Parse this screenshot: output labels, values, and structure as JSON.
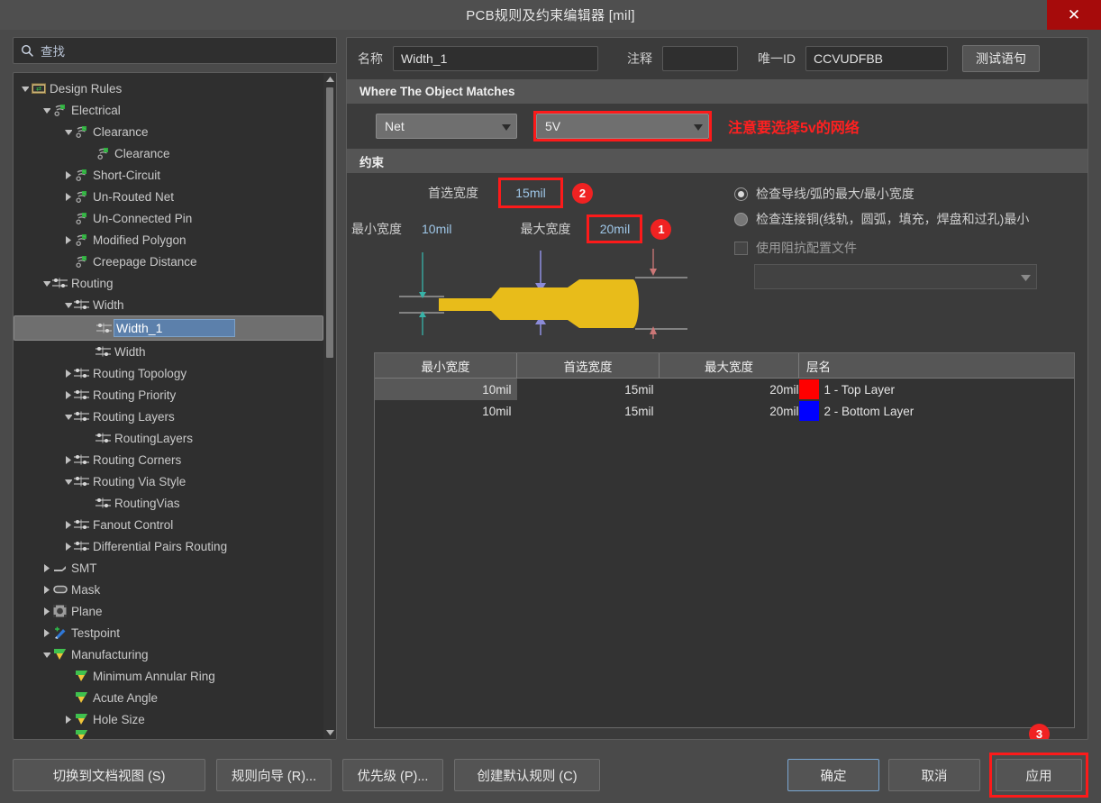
{
  "window": {
    "title": "PCB规则及约束编辑器 [mil]",
    "close_label": "✕"
  },
  "search": {
    "placeholder": "查找",
    "value": "查找",
    "icon": "search-icon"
  },
  "tree": {
    "items": [
      {
        "label": "Design Rules",
        "depth": 0,
        "arrow": "down",
        "icon": "design-rules-folder-icon",
        "selected": false
      },
      {
        "label": "Electrical",
        "depth": 1,
        "arrow": "down",
        "icon": "electrical-icon",
        "selected": false
      },
      {
        "label": "Clearance",
        "depth": 2,
        "arrow": "down",
        "icon": "electrical-icon",
        "selected": false
      },
      {
        "label": "Clearance",
        "depth": 3,
        "arrow": "none",
        "icon": "electrical-icon",
        "selected": false
      },
      {
        "label": "Short-Circuit",
        "depth": 2,
        "arrow": "right",
        "icon": "electrical-icon",
        "selected": false
      },
      {
        "label": "Un-Routed Net",
        "depth": 2,
        "arrow": "right",
        "icon": "electrical-icon",
        "selected": false
      },
      {
        "label": "Un-Connected Pin",
        "depth": 2,
        "arrow": "none",
        "icon": "electrical-icon",
        "selected": false
      },
      {
        "label": "Modified Polygon",
        "depth": 2,
        "arrow": "right",
        "icon": "electrical-icon",
        "selected": false
      },
      {
        "label": "Creepage Distance",
        "depth": 2,
        "arrow": "none",
        "icon": "electrical-icon",
        "selected": false
      },
      {
        "label": "Routing",
        "depth": 1,
        "arrow": "down",
        "icon": "routing-icon",
        "selected": false
      },
      {
        "label": "Width",
        "depth": 2,
        "arrow": "down",
        "icon": "routing-icon",
        "selected": false
      },
      {
        "label": "Width_1",
        "depth": 3,
        "arrow": "none",
        "icon": "routing-icon",
        "selected": true
      },
      {
        "label": "Width",
        "depth": 3,
        "arrow": "none",
        "icon": "routing-icon",
        "selected": false
      },
      {
        "label": "Routing Topology",
        "depth": 2,
        "arrow": "right",
        "icon": "routing-icon",
        "selected": false
      },
      {
        "label": "Routing Priority",
        "depth": 2,
        "arrow": "right",
        "icon": "routing-icon",
        "selected": false
      },
      {
        "label": "Routing Layers",
        "depth": 2,
        "arrow": "down",
        "icon": "routing-icon",
        "selected": false
      },
      {
        "label": "RoutingLayers",
        "depth": 3,
        "arrow": "none",
        "icon": "routing-icon",
        "selected": false
      },
      {
        "label": "Routing Corners",
        "depth": 2,
        "arrow": "right",
        "icon": "routing-icon",
        "selected": false
      },
      {
        "label": "Routing Via Style",
        "depth": 2,
        "arrow": "down",
        "icon": "routing-icon",
        "selected": false
      },
      {
        "label": "RoutingVias",
        "depth": 3,
        "arrow": "none",
        "icon": "routing-icon",
        "selected": false
      },
      {
        "label": "Fanout Control",
        "depth": 2,
        "arrow": "right",
        "icon": "routing-icon",
        "selected": false
      },
      {
        "label": "Differential Pairs Routing",
        "depth": 2,
        "arrow": "right",
        "icon": "routing-icon",
        "selected": false
      },
      {
        "label": "SMT",
        "depth": 1,
        "arrow": "right",
        "icon": "smt-icon",
        "selected": false
      },
      {
        "label": "Mask",
        "depth": 1,
        "arrow": "right",
        "icon": "mask-icon",
        "selected": false
      },
      {
        "label": "Plane",
        "depth": 1,
        "arrow": "right",
        "icon": "plane-icon",
        "selected": false
      },
      {
        "label": "Testpoint",
        "depth": 1,
        "arrow": "right",
        "icon": "testpoint-icon",
        "selected": false
      },
      {
        "label": "Manufacturing",
        "depth": 1,
        "arrow": "down",
        "icon": "manufacturing-icon",
        "selected": false
      },
      {
        "label": "Minimum Annular Ring",
        "depth": 2,
        "arrow": "none",
        "icon": "manufacturing-icon",
        "selected": false
      },
      {
        "label": "Acute Angle",
        "depth": 2,
        "arrow": "none",
        "icon": "manufacturing-icon",
        "selected": false
      },
      {
        "label": "Hole Size",
        "depth": 2,
        "arrow": "right",
        "icon": "manufacturing-icon",
        "selected": false
      }
    ]
  },
  "rule": {
    "name_label": "名称",
    "name_value": "Width_1",
    "comment_label": "注释",
    "comment_value": "",
    "uid_label": "唯一ID",
    "uid_value": "CCVUDFBB",
    "test_query_button": "测试语句"
  },
  "where_section": {
    "header": "Where The Object Matches",
    "scope_select": "Net",
    "net_select": "5V",
    "annotation": "注意要选择5v的网络"
  },
  "constraints": {
    "header": "约束",
    "preferred_label": "首选宽度",
    "preferred_value": "15mil",
    "min_label": "最小宽度",
    "min_value": "10mil",
    "max_label": "最大宽度",
    "max_value": "20mil",
    "radio1_label": "检查导线/弧的最大/最小宽度",
    "radio2_label": "检查连接铜(线轨，圆弧，填充，焊盘和过孔)最小",
    "checkbox_label": "使用阻抗配置文件",
    "impedance_select": ""
  },
  "table": {
    "columns": [
      "最小宽度",
      "首选宽度",
      "最大宽度",
      "层名"
    ],
    "rows": [
      {
        "min": "10mil",
        "preferred": "15mil",
        "max": "20mil",
        "color": "#ff0000",
        "layer": "1 - Top Layer",
        "selected": true
      },
      {
        "min": "10mil",
        "preferred": "15mil",
        "max": "20mil",
        "color": "#0000ff",
        "layer": "2 - Bottom Layer",
        "selected": false
      }
    ]
  },
  "footer": {
    "doc_view": "切换到文档视图 (S)",
    "rule_wizard": "规则向导 (R)...",
    "priority": "优先级 (P)...",
    "create_default": "创建默认规则 (C)",
    "ok": "确定",
    "cancel": "取消",
    "apply": "应用"
  },
  "annotations": {
    "badge1": "1",
    "badge2": "2",
    "badge3": "3"
  },
  "colors": {
    "accent_red": "#fc1a1a",
    "badge_red": "#f02222",
    "track_gold": "#e8bc1a",
    "top_layer": "#ff0000",
    "bottom_layer": "#0000ff"
  }
}
